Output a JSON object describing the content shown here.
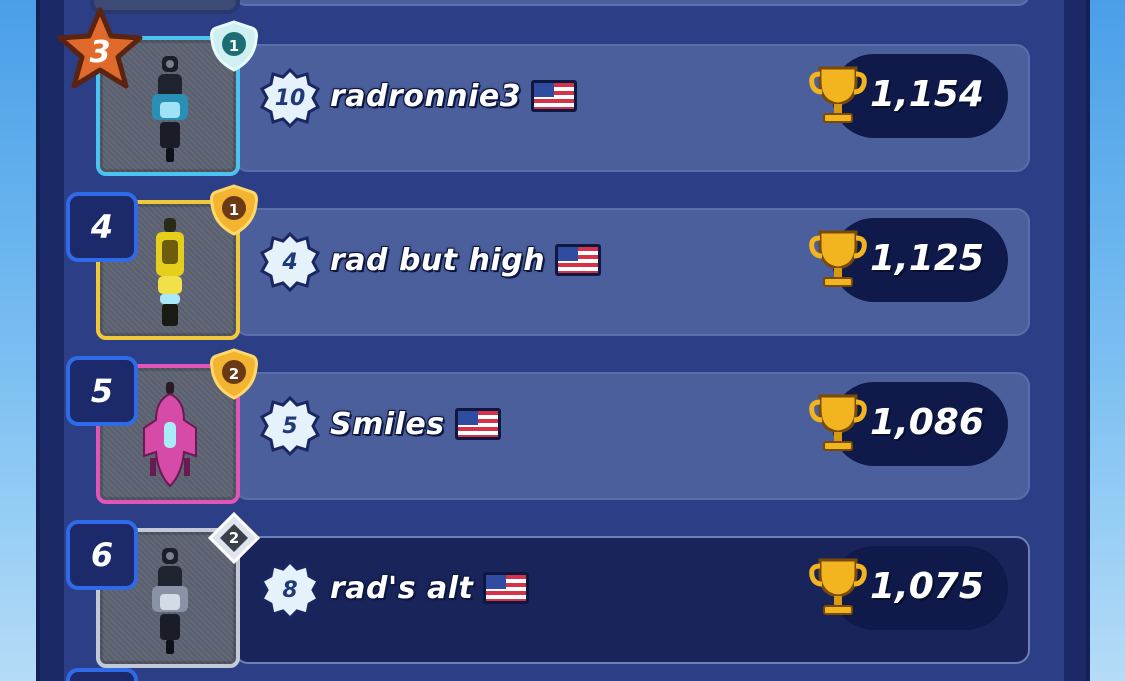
{
  "leaderboard": {
    "rows": [
      {
        "rank": "3",
        "rank_style": "bronze-star",
        "badge": "1",
        "badge_style": "teal-shield",
        "thumb_style": "blue",
        "level": "10",
        "name": "radronnie3",
        "country_flag": "us-flag-icon",
        "trophies": "1,154",
        "highlighted": false
      },
      {
        "rank": "4",
        "rank_style": "box",
        "badge": "1",
        "badge_style": "bronze-shield",
        "thumb_style": "yellow",
        "level": "4",
        "name": "rad but high",
        "country_flag": "us-flag-icon",
        "trophies": "1,125",
        "highlighted": false
      },
      {
        "rank": "5",
        "rank_style": "box",
        "badge": "2",
        "badge_style": "bronze-shield",
        "thumb_style": "pink",
        "level": "5",
        "name": "Smiles",
        "country_flag": "us-flag-icon",
        "trophies": "1,086",
        "highlighted": false
      },
      {
        "rank": "6",
        "rank_style": "box",
        "badge": "2",
        "badge_style": "silver-diamond",
        "thumb_style": "silver",
        "level": "8",
        "name": "rad's alt",
        "country_flag": "us-flag-icon",
        "trophies": "1,075",
        "highlighted": true
      }
    ]
  },
  "colors": {
    "panel": "#1b2a66",
    "card": "#4b5f9c",
    "highlight_card": "#18245a",
    "trophy_pill": "#0f1a4a",
    "rank_border": "#2f6ae8",
    "trophy_gold": "#f3b51f"
  }
}
